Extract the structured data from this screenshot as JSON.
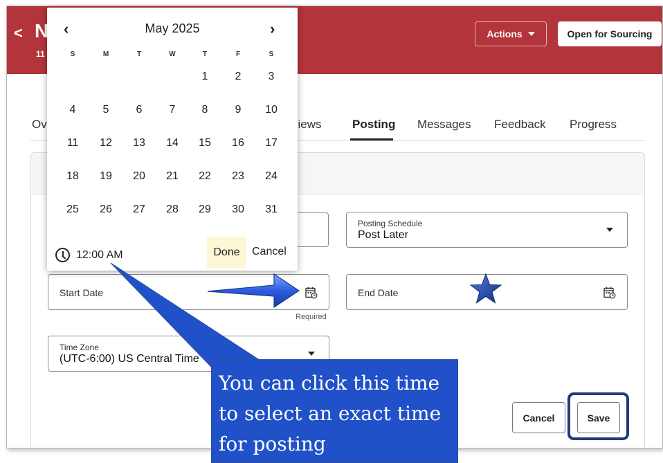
{
  "header": {
    "back_glyph": "<",
    "title": "N",
    "subtitle": "11",
    "actions_label": "Actions",
    "open_for_sourcing_label": "Open for Sourcing",
    "background_color": "#b3343a"
  },
  "tabs": [
    {
      "label": "Ov",
      "active": false
    },
    {
      "label": "views",
      "active": false
    },
    {
      "label": "Posting",
      "active": true
    },
    {
      "label": "Messages",
      "active": false
    },
    {
      "label": "Feedback",
      "active": false
    },
    {
      "label": "Progress",
      "active": false
    }
  ],
  "form": {
    "posting_schedule": {
      "label": "Posting Schedule",
      "value": "Post Later"
    },
    "start_date": {
      "label": "Start Date",
      "hint": "Required"
    },
    "end_date": {
      "label": "End Date"
    },
    "time_zone": {
      "label": "Time Zone",
      "value": "(UTC-6:00) US Central Time"
    },
    "cancel_label": "Cancel",
    "save_label": "Save"
  },
  "datepicker": {
    "month_label": "May 2025",
    "prev_glyph": "‹",
    "next_glyph": "›",
    "weekdays": [
      "S",
      "M",
      "T",
      "W",
      "T",
      "F",
      "S"
    ],
    "weeks": [
      [
        "",
        "",
        "",
        "",
        "1",
        "2",
        "3"
      ],
      [
        "4",
        "5",
        "6",
        "7",
        "8",
        "9",
        "10"
      ],
      [
        "11",
        "12",
        "13",
        "14",
        "15",
        "16",
        "17"
      ],
      [
        "18",
        "19",
        "20",
        "21",
        "22",
        "23",
        "24"
      ],
      [
        "25",
        "26",
        "27",
        "28",
        "29",
        "30",
        "31"
      ]
    ],
    "time": "12:00 AM",
    "done_label": "Done",
    "cancel_label": "Cancel"
  },
  "annotation": {
    "lines": [
      "You can click this time",
      "to select an exact time",
      "for posting"
    ],
    "callout_color": "#2051c8",
    "ring_color": "#233a7a"
  }
}
